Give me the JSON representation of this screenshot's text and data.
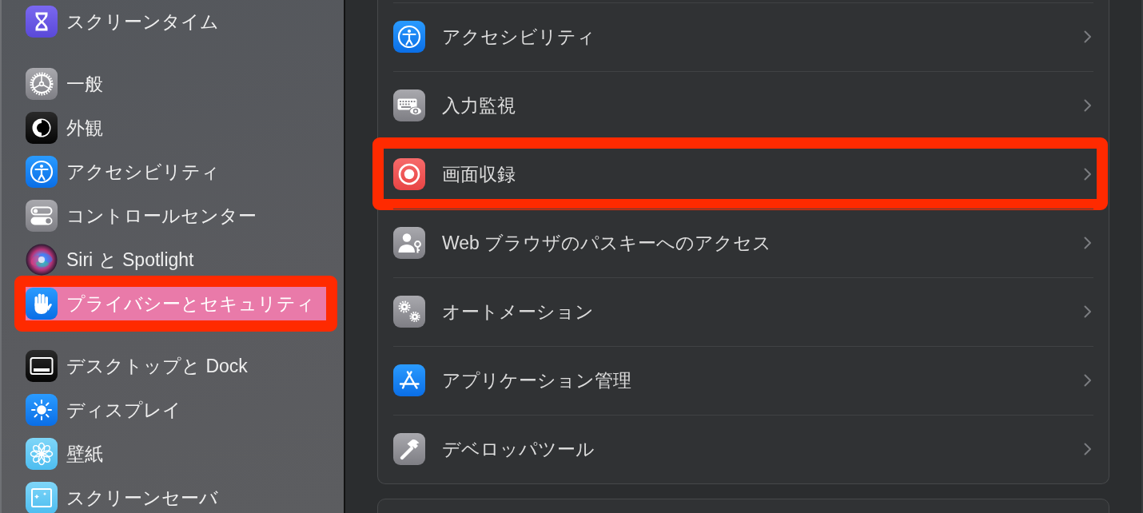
{
  "sidebar": {
    "groups": [
      {
        "items": [
          {
            "kind": "hourglass",
            "label": "スクリーンタイム",
            "selected": false,
            "annotated": false
          }
        ]
      },
      {
        "items": [
          {
            "kind": "gear",
            "label": "一般",
            "selected": false,
            "annotated": false
          },
          {
            "kind": "appearance",
            "label": "外観",
            "selected": false,
            "annotated": false
          },
          {
            "kind": "accessibility",
            "label": "アクセシビリティ",
            "selected": false,
            "annotated": false
          },
          {
            "kind": "toggles",
            "label": "コントロールセンター",
            "selected": false,
            "annotated": false
          },
          {
            "kind": "orb",
            "label": "Siri と Spotlight",
            "selected": false,
            "annotated": false
          },
          {
            "kind": "hand",
            "label": "プライバシーとセキュリティ",
            "selected": true,
            "annotated": true
          }
        ]
      },
      {
        "items": [
          {
            "kind": "dock",
            "label": "デスクトップと Dock",
            "selected": false,
            "annotated": false
          },
          {
            "kind": "sun",
            "label": "ディスプレイ",
            "selected": false,
            "annotated": false
          },
          {
            "kind": "flower",
            "label": "壁紙",
            "selected": false,
            "annotated": false
          },
          {
            "kind": "screensaver",
            "label": "スクリーンセーバ",
            "selected": false,
            "annotated": false
          }
        ]
      }
    ]
  },
  "privacy_list": {
    "rows": [
      {
        "kind": "accessibility",
        "label": "アクセシビリティ",
        "annotated": false
      },
      {
        "kind": "keyboard",
        "label": "入力監視",
        "annotated": false
      },
      {
        "kind": "record",
        "label": "画面収録",
        "annotated": true
      },
      {
        "kind": "passkey",
        "label": "Web ブラウザのパスキーへのアクセス",
        "annotated": false
      },
      {
        "kind": "gears",
        "label": "オートメーション",
        "annotated": false
      },
      {
        "kind": "appstore",
        "label": "アプリケーション管理",
        "annotated": false
      },
      {
        "kind": "hammer",
        "label": "デベロッパツール",
        "annotated": false
      }
    ]
  }
}
